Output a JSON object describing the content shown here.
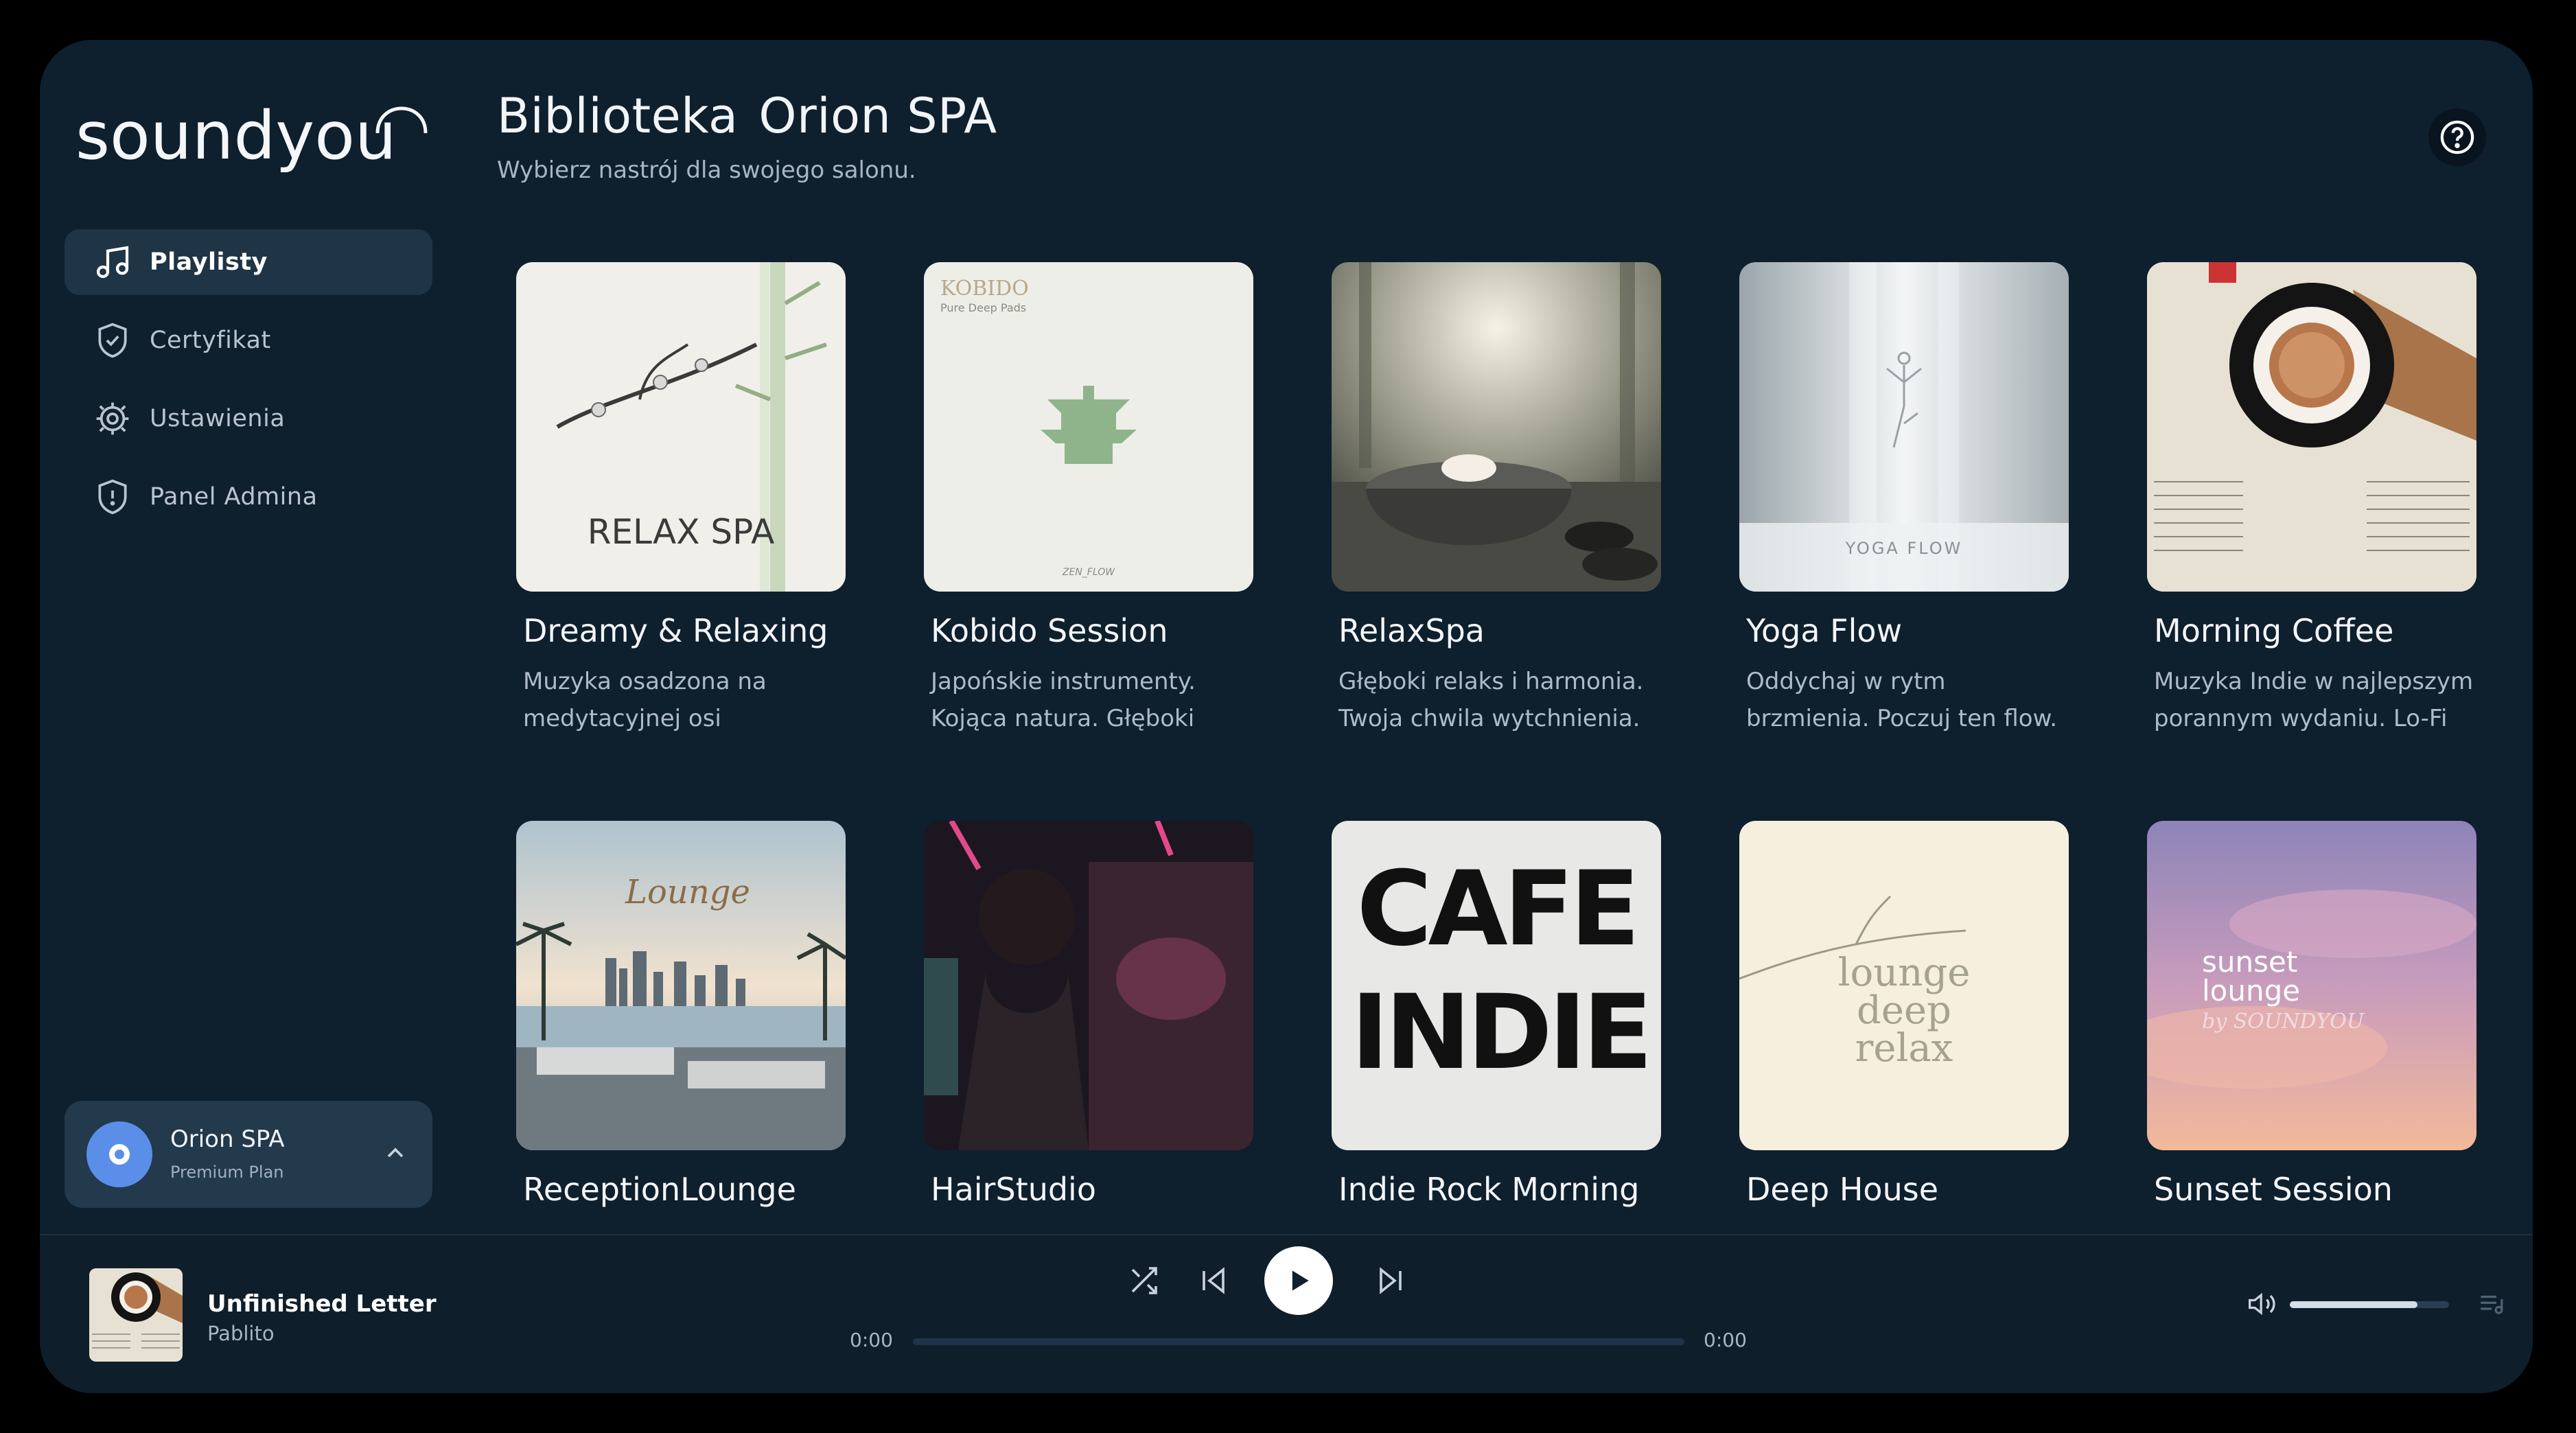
{
  "brand": {
    "logo_text": "soundyou"
  },
  "sidebar": {
    "items": [
      {
        "label": "Playlisty",
        "icon": "music-note-icon",
        "active": true
      },
      {
        "label": "Certyfikat",
        "icon": "shield-check-icon",
        "active": false
      },
      {
        "label": "Ustawienia",
        "icon": "gear-icon",
        "active": false
      },
      {
        "label": "Panel Admina",
        "icon": "shield-alert-icon",
        "active": false
      }
    ]
  },
  "account": {
    "name": "Orion SPA",
    "plan": "Premium Plan"
  },
  "header": {
    "title_part1": "Biblioteka",
    "title_part2": "Orion SPA",
    "subtitle": "Wybierz nastrój dla swojego salonu."
  },
  "playlists": [
    {
      "title": "Dreamy & Relaxing",
      "desc": "Muzyka osadzona na medytacyjnej osi",
      "art_text": "RELAX SPA"
    },
    {
      "title": "Kobido Session",
      "desc": "Japońskie instrumenty. Kojąca natura. Głęboki",
      "art_text": "KOBIDO",
      "art_sub": "Pure Deep Pads",
      "art_foot": "ZEN_FLOW"
    },
    {
      "title": "RelaxSpa",
      "desc": "Głęboki relaks i harmonia. Twoja chwila wytchnienia."
    },
    {
      "title": "Yoga Flow",
      "desc": "Oddychaj w rytm brzmienia. Poczuj ten flow.",
      "art_text": "YOGA FLOW"
    },
    {
      "title": "Morning Coffee",
      "desc": "Muzyka Indie w najlepszym porannym wydaniu. Lo-Fi"
    },
    {
      "title": "ReceptionLounge",
      "desc": "",
      "art_text": "Lounge"
    },
    {
      "title": "HairStudio",
      "desc": ""
    },
    {
      "title": "Indie Rock Morning",
      "desc": "",
      "art_text_1": "CAFE",
      "art_text_2": "INDIE"
    },
    {
      "title": "Deep House",
      "desc": "",
      "art_text_1": "lounge",
      "art_text_2": "deep",
      "art_text_3": "relax"
    },
    {
      "title": "Sunset Session",
      "desc": "",
      "art_text_1": "sunset",
      "art_text_2": "lounge",
      "art_text_3": "by SOUNDYOU"
    }
  ],
  "player": {
    "track": "Unfinished Letter",
    "artist": "Pablito",
    "time_current": "0:00",
    "time_total": "0:00",
    "progress": 0,
    "volume": 0.8
  },
  "colors": {
    "background": "#0e1f2e",
    "active_nav": "#1f3445",
    "accent": "#5b8ee8"
  }
}
